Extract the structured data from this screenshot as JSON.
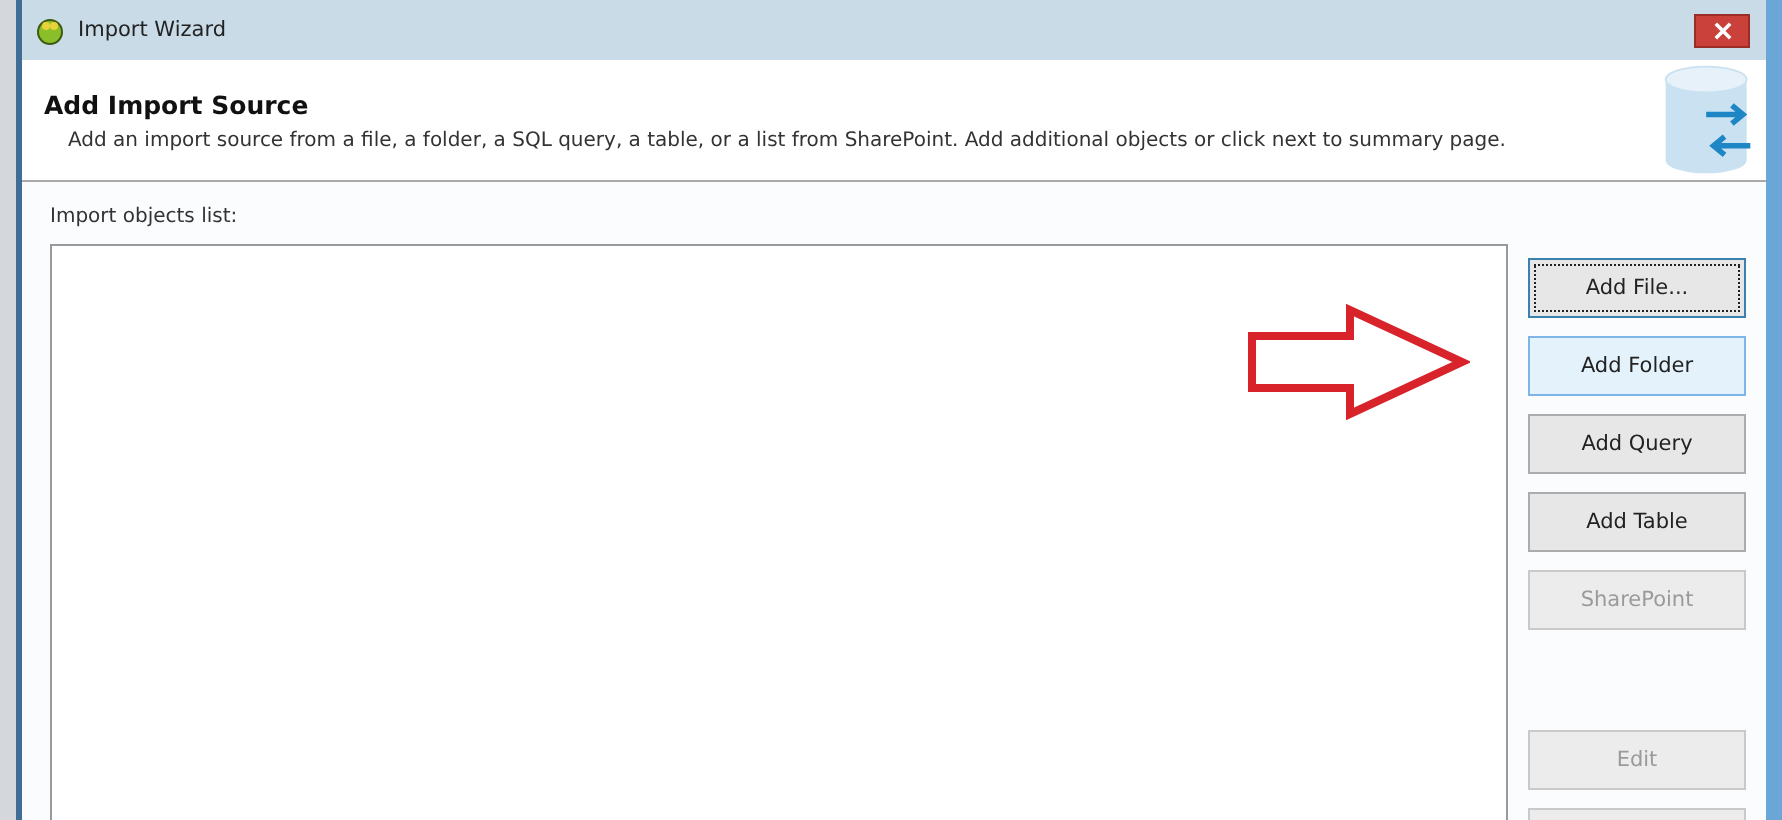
{
  "window": {
    "title": "Import Wizard"
  },
  "header": {
    "title": "Add Import Source",
    "description": "Add an import source from a file, a folder, a SQL query, a table, or a list from SharePoint. Add additional objects or click next to summary page."
  },
  "list": {
    "label": "Import objects list:"
  },
  "buttons": [
    {
      "label": "Add File...",
      "disabled": false,
      "focused": true,
      "highlighted": false
    },
    {
      "label": "Add Folder",
      "disabled": false,
      "focused": false,
      "highlighted": true
    },
    {
      "label": "Add Query",
      "disabled": false,
      "focused": false,
      "highlighted": false
    },
    {
      "label": "Add Table",
      "disabled": false,
      "focused": false,
      "highlighted": false
    },
    {
      "label": "SharePoint",
      "disabled": true,
      "focused": false,
      "highlighted": false
    }
  ],
  "lower_buttons": [
    {
      "label": "Edit",
      "disabled": true,
      "focused": false,
      "highlighted": false
    },
    {
      "disabled": true,
      "focused": false,
      "highlighted": false
    }
  ]
}
